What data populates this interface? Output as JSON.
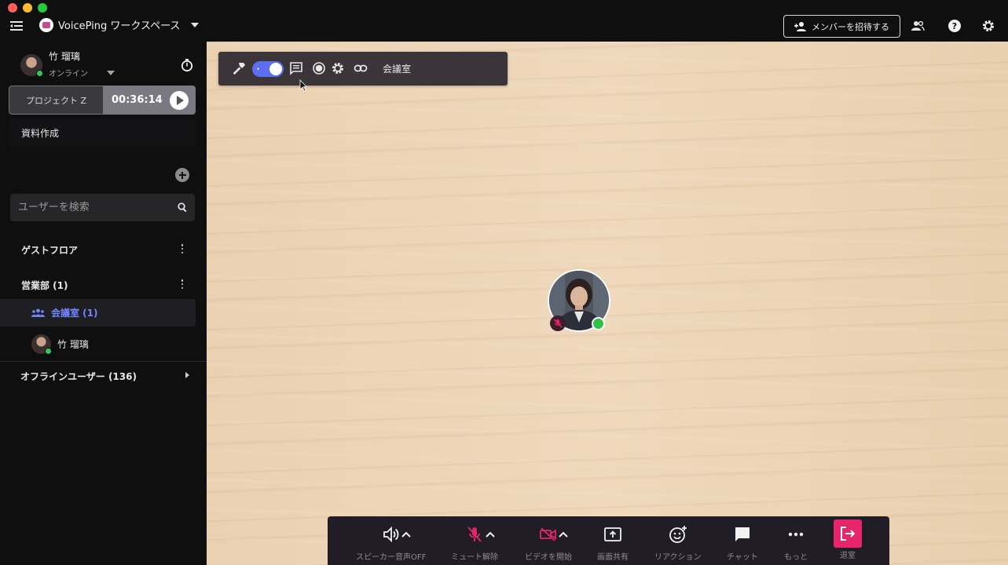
{
  "app": {
    "workspace_name": "VoicePing ワークスペース",
    "invite_label": "メンバーを招待する"
  },
  "profile": {
    "name": "竹 瑠璃",
    "status": "オンライン"
  },
  "project": {
    "name": "プロジェクト Z",
    "elapsed": "00:36:14",
    "task": "資料作成"
  },
  "search": {
    "placeholder": "ユーザーを検索"
  },
  "floors": {
    "guest": "ゲストフロア",
    "sales": "営業部 (1)",
    "room_label": "会議室 (1)",
    "member_name": "竹 瑠璃",
    "offline": "オフラインユーザー (136)"
  },
  "room": {
    "title": "会議室"
  },
  "controls": {
    "speaker": "スピーカー音声OFF",
    "mute": "ミュート解除",
    "video": "ビデオを開始",
    "share": "画面共有",
    "reaction": "リアクション",
    "chat": "チャット",
    "more": "もっと",
    "leave": "退室"
  },
  "colors": {
    "accent": "#5c6ff0",
    "room_label": "#6f86ff",
    "danger": "#e8246a",
    "muted_red": "#e8246a",
    "online": "#2fc247"
  }
}
